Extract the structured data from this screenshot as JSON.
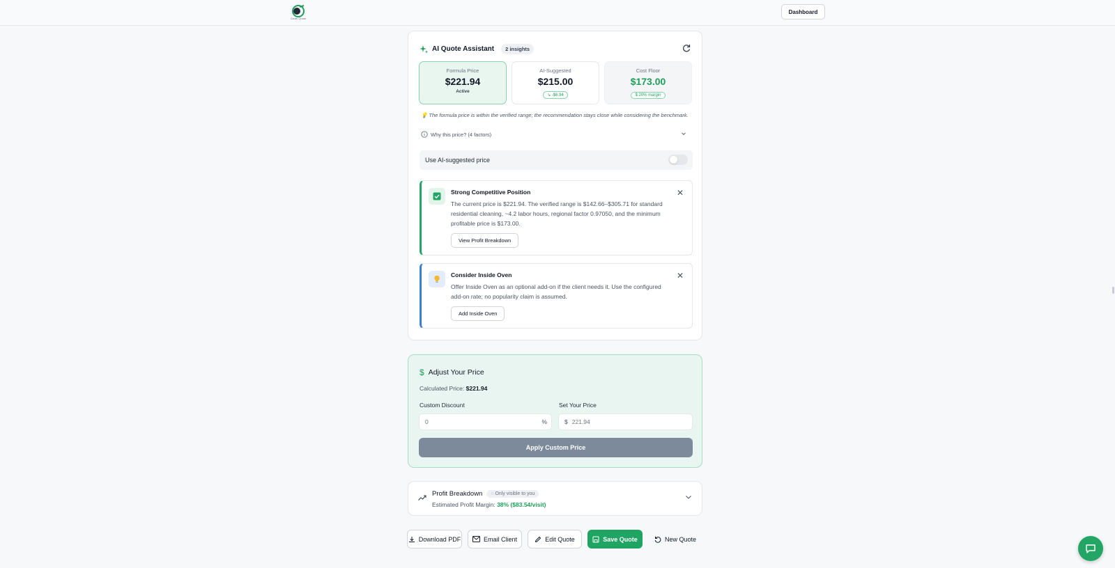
{
  "header": {
    "logo_name": "Clean Quote",
    "dashboard_label": "Dashboard"
  },
  "ai_assistant": {
    "title": "AI Quote Assistant",
    "insights_badge": "2 insights",
    "prices": {
      "formula": {
        "label": "Formula Price",
        "value": "$221.94",
        "sub": "Active"
      },
      "suggested": {
        "label": "AI-Suggested",
        "value": "$215.00",
        "chip": "↘ -$6.94"
      },
      "floor": {
        "label": "Cost Floor",
        "value": "$173.00",
        "chip": "$ 20% margin"
      }
    },
    "note": "💡 The formula price is within the verified range; the recommendation stays close while considering the benchmark.",
    "why_label": "Why this price? (4 factors)",
    "toggle_label": "Use AI-suggested price",
    "toggle_on": false,
    "insights": [
      {
        "title": "Strong Competitive Position",
        "body": "The current price is $221.94. The verified range is $142.66–$305.71 for standard residential cleaning, ~4.2 labor hours, regional factor 0.97050, and the minimum profitable price is $173.00.",
        "action": "View Profit Breakdown"
      },
      {
        "title": "Consider Inside Oven",
        "body": "Offer Inside Oven as an optional add-on if the client needs it. Use the configured add-on rate; no popularity claim is assumed.",
        "action": "Add Inside Oven"
      }
    ]
  },
  "adjust": {
    "title": "Adjust Your Price",
    "calc_label": "Calculated Price:",
    "calc_value": "$221.94",
    "discount_label": "Custom Discount",
    "discount_value": "0",
    "discount_suffix": "%",
    "price_label": "Set Your Price",
    "price_prefix": "$",
    "price_value": "221.94",
    "apply_label": "Apply Custom Price"
  },
  "profit": {
    "title": "Profit Breakdown",
    "visibility_chip": "Only visible to you",
    "margin_label": "Estimated Profit Margin:",
    "margin_value": "38% ($83.54/visit)"
  },
  "actions": {
    "download": "Download PDF",
    "email": "Email Client",
    "edit": "Edit Quote",
    "save": "Save Quote",
    "new": "New Quote"
  },
  "colors": {
    "accent_green": "#1fa463",
    "insight_blue": "#3b7ddd",
    "apply_disabled": "#7d8a9c"
  }
}
